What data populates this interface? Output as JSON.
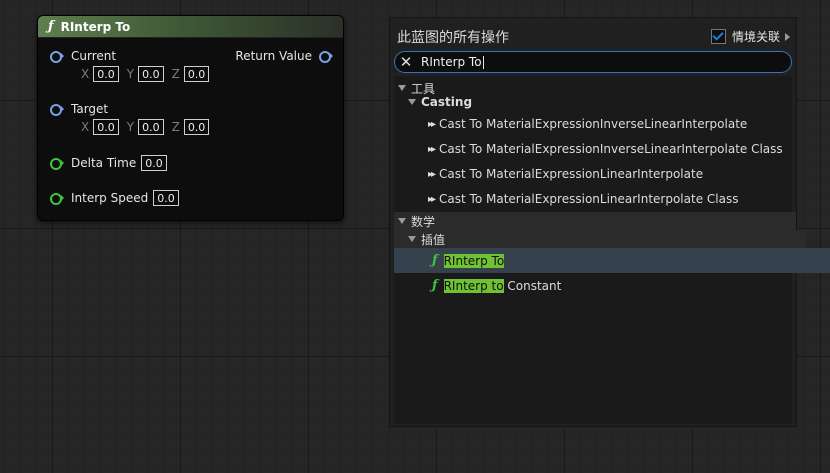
{
  "node": {
    "title": "RInterp To",
    "func_glyph": "ƒ",
    "pins": {
      "current": {
        "label": "Current",
        "x": "0.0",
        "y": "0.0",
        "z": "0.0"
      },
      "target": {
        "label": "Target",
        "x": "0.0",
        "y": "0.0",
        "z": "0.0"
      },
      "delta_time": {
        "label": "Delta Time",
        "value": "0.0"
      },
      "interp_speed": {
        "label": "Interp Speed",
        "value": "0.0"
      },
      "return_value": {
        "label": "Return Value"
      }
    },
    "axis_labels": {
      "x": "X",
      "y": "Y",
      "z": "Z"
    }
  },
  "menu": {
    "title": "此蓝图的所有操作",
    "context_sensitive": {
      "label": "情境关联",
      "checked": true
    },
    "search": {
      "value": "RInterp To",
      "clear_glyph": "✕"
    },
    "sections": [
      {
        "label": "工具",
        "sub": "Casting",
        "items": [
          "Cast To MaterialExpressionInverseLinearInterpolate",
          "Cast To MaterialExpressionInverseLinearInterpolate Class",
          "Cast To MaterialExpressionLinearInterpolate",
          "Cast To MaterialExpressionLinearInterpolate Class"
        ]
      },
      {
        "label": "数学",
        "sub": "插值",
        "items": [
          {
            "match": "RInterp To",
            "rest": ""
          },
          {
            "match": "RInterp to",
            "rest": " Constant"
          }
        ]
      }
    ]
  },
  "colors": {
    "vector_pin": "#7aa1e8",
    "float_pin": "#3fc43f",
    "search_highlight": "#6fc231",
    "selection": "#35414d",
    "search_border": "#2f77c4"
  }
}
